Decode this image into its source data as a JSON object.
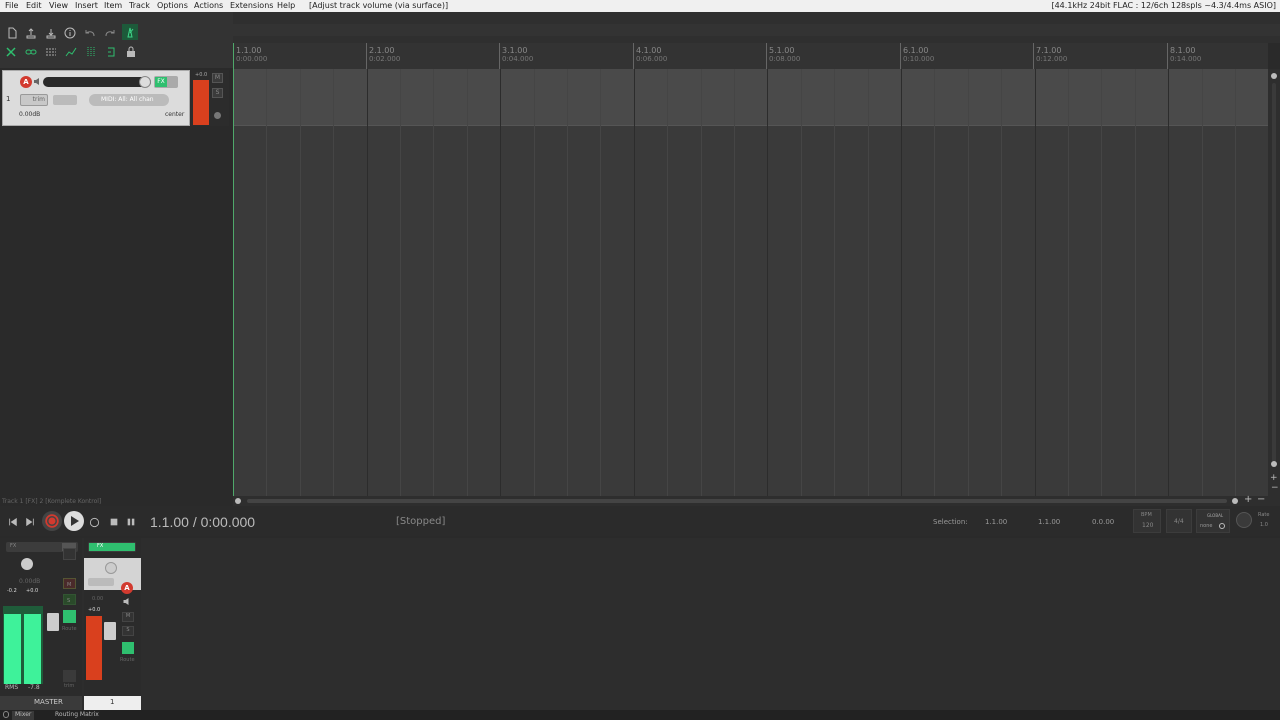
{
  "menu": [
    "File",
    "Edit",
    "View",
    "Insert",
    "Item",
    "Track",
    "Options",
    "Actions",
    "Extensions",
    "Help"
  ],
  "window_title": "[Adjust track volume (via surface)]",
  "audio_status": "[44.1kHz 24bit FLAC : 12/6ch 128spls ~4.3/4.4ms ASIO]",
  "ruler": [
    {
      "bar": "1.1.00",
      "time": "0:00.000"
    },
    {
      "bar": "2.1.00",
      "time": "0:02.000"
    },
    {
      "bar": "3.1.00",
      "time": "0:04.000"
    },
    {
      "bar": "4.1.00",
      "time": "0:06.000"
    },
    {
      "bar": "5.1.00",
      "time": "0:08.000"
    },
    {
      "bar": "6.1.00",
      "time": "0:10.000"
    },
    {
      "bar": "7.1.00",
      "time": "0:12.000"
    },
    {
      "bar": "8.1.00",
      "time": "0:14.000"
    }
  ],
  "track1": {
    "number": "1",
    "fx_label": "FX",
    "input_label": "MIDI: All: All chan",
    "trim_label": "trim",
    "volume": "0.00dB",
    "pan": "center",
    "meter_peak": "+0.0",
    "mute": "M",
    "solo": "S"
  },
  "fx_chain_title": "Track 1 [FX] 2 [Komplete Kontrol]",
  "transport": {
    "position": "1.1.00 / 0:00.000",
    "state": "[Stopped]",
    "selection_label": "Selection:",
    "sel_start": "1.1.00",
    "sel_end": "1.1.00",
    "sel_len": "0.0.00",
    "bpm_label": "BPM",
    "bpm": "120",
    "timesig": "4/4",
    "global_label": "GLOBAL",
    "global_val": "none",
    "rate_label": "Rate",
    "rate": "1.0"
  },
  "master": {
    "label": "MASTER",
    "fx_label": "FX",
    "volume": "0.00dB",
    "peak_l": "-0.2",
    "peak_r": "+0.0",
    "rms_label": "RMS",
    "rms_val": "-7.8",
    "route_label": "Route",
    "trim_label": "trim",
    "mute": "M",
    "solo": "S"
  },
  "mixer_track1": {
    "number": "1",
    "fx_label": "FX",
    "volume": "0.00",
    "peak": "+0.0",
    "route_label": "Route",
    "mute": "M",
    "solo": "S"
  },
  "bottom_tabs": [
    "Mixer",
    "Routing Matrix"
  ],
  "colors": {
    "accent_green": "#2fbf6f",
    "meter_red": "#d9401e",
    "arm_red": "#d23a2f"
  }
}
